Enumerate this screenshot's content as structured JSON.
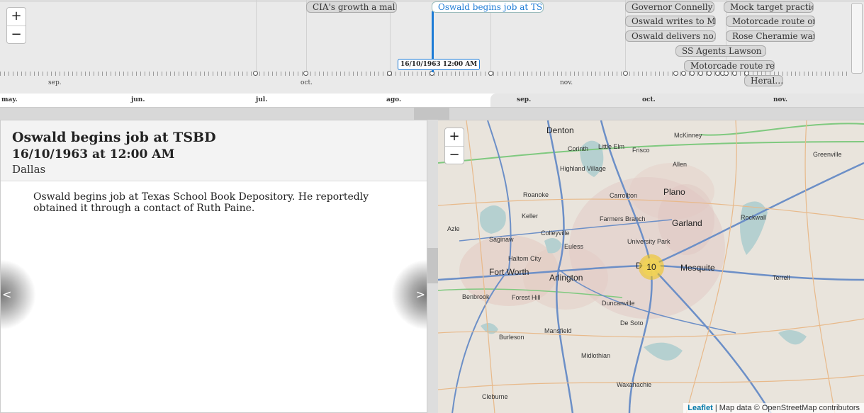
{
  "timeline": {
    "zoom_in": "+",
    "zoom_out": "−",
    "minor_labels": [
      "sep.",
      "oct.",
      "nov."
    ],
    "major_labels": [
      "may.",
      "jun.",
      "jul.",
      "ago.",
      "sep.",
      "oct.",
      "nov."
    ],
    "selected_date": "16/10/1963 12:00 AM",
    "events": [
      "CIA's growth a mal…",
      "Oswald begins job at TSBD",
      "Governor Connelly…",
      "Mock target practic…",
      "Oswald writes to M…",
      "Motorcade route on…",
      "Oswald delivers no…",
      "Rose Cheramie war…",
      "SS Agents Lawson …",
      "Motorcade route re…",
      "Heral…"
    ],
    "selected_event_index": 1
  },
  "detail": {
    "title": "Oswald begins job at TSBD",
    "date": "16/10/1963 at 12:00 AM",
    "place": "Dallas",
    "body": "Oswald begins job at Texas School Book Depository. He reportedly obtained it through a contact of Ruth Paine.",
    "prev": "<",
    "next": ">"
  },
  "map": {
    "zoom_in": "+",
    "zoom_out": "−",
    "cluster_count": "10",
    "cities_major": [
      "Fort Worth",
      "Arlington",
      "Mesquite",
      "Garland",
      "Plano",
      "Denton"
    ],
    "cities_minor": [
      "McKinney",
      "Greenville",
      "Corinth",
      "Little Elm",
      "Frisco",
      "Highland Village",
      "Allen",
      "Roanoke",
      "Carrollton",
      "Rockwall",
      "Keller",
      "Farmers Branch",
      "Azle",
      "Colleyville",
      "University Park",
      "Saginaw",
      "Euless",
      "Haltom City",
      "Terrell",
      "Benbrook",
      "Forest Hill",
      "Duncanville",
      "De Soto",
      "Mansfield",
      "Burleson",
      "Midlothian",
      "Waxahachie",
      "Cleburne",
      "D"
    ],
    "attribution_link": "Leaflet",
    "attribution_text": " | Map data © OpenStreetMap contributors"
  },
  "colors": {
    "accent": "#1d7bd6",
    "cluster": "#f0c20c",
    "map_bg": "#e9e4dc"
  }
}
